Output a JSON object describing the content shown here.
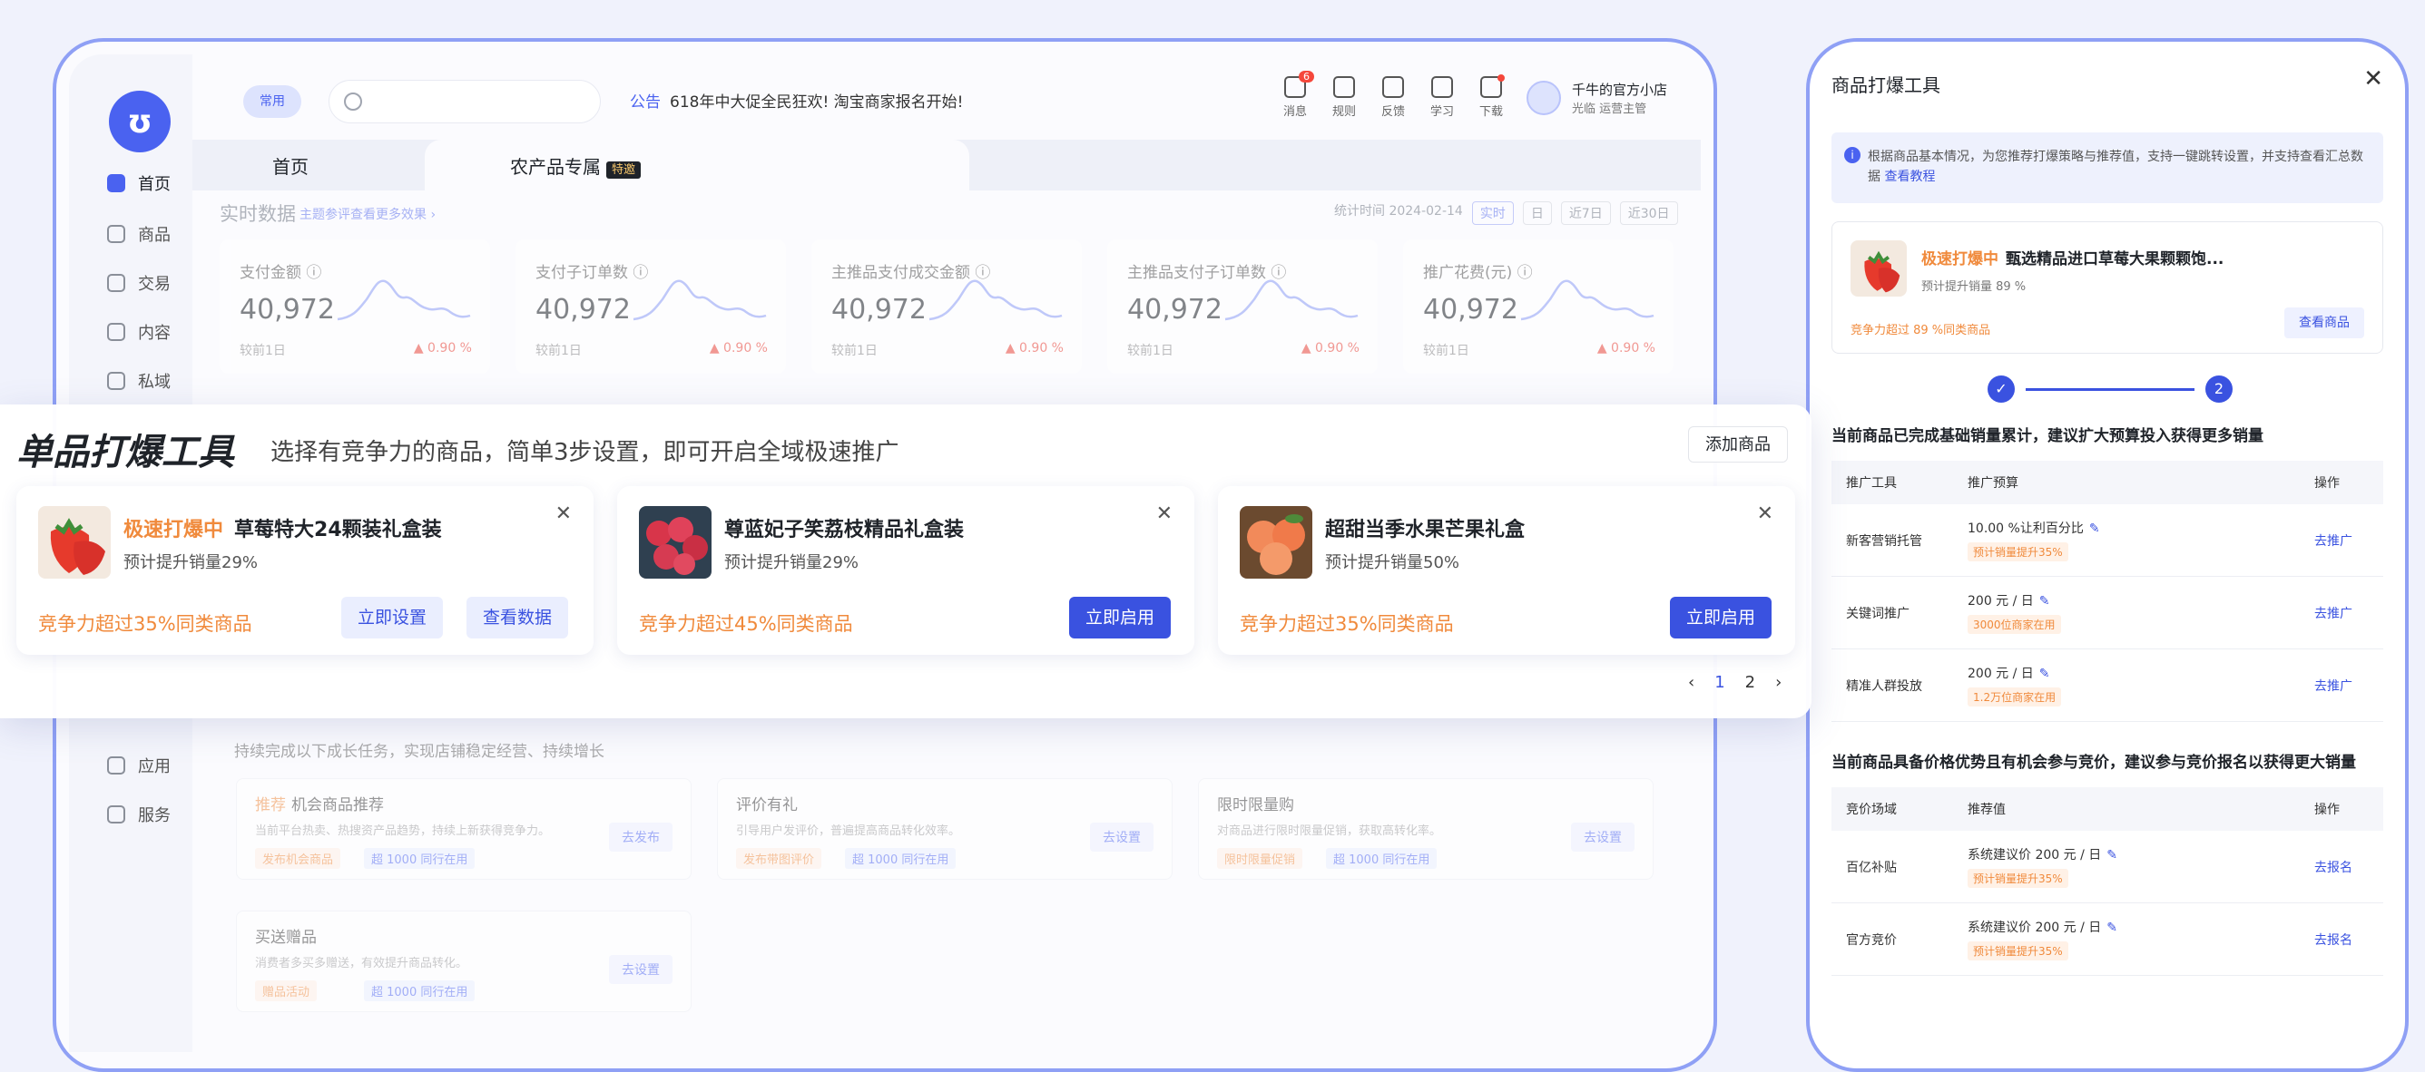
{
  "app": {
    "pill_tag": "常用",
    "search_placeholder": "",
    "notice_tag": "公告",
    "notice_text": "618年中大促全民狂欢! 淘宝商家报名开始!"
  },
  "tools": [
    {
      "label": "消息",
      "icon": "message-icon",
      "badge": "6"
    },
    {
      "label": "规则",
      "icon": "rules-icon"
    },
    {
      "label": "反馈",
      "icon": "feedback-icon"
    },
    {
      "label": "学习",
      "icon": "learn-icon"
    },
    {
      "label": "下载",
      "icon": "download-icon",
      "dot": true
    }
  ],
  "user": {
    "name": "千牛的官方小店",
    "sub": "光临  运营主管"
  },
  "sidebar": {
    "items": [
      {
        "label": "首页",
        "icon": "home-icon",
        "active": true
      },
      {
        "label": "商品",
        "icon": "goods-icon"
      },
      {
        "label": "交易",
        "icon": "trade-icon"
      },
      {
        "label": "内容",
        "icon": "content-icon"
      },
      {
        "label": "私域",
        "icon": "private-domain-icon"
      },
      {
        "label": "应用",
        "icon": "apps-icon"
      },
      {
        "label": "服务",
        "icon": "service-icon"
      }
    ]
  },
  "tabs": [
    {
      "label": "首页"
    },
    {
      "label": "农产品专属",
      "tag": "特邀"
    }
  ],
  "realtime": {
    "title": "实时数据",
    "link": "主题参评查看更多效果 ›",
    "update": "统计时间 2024-02-14",
    "ranges": [
      "实时",
      "日",
      "近7日",
      "近30日"
    ],
    "metrics": [
      {
        "label": "支付金额 ⓘ",
        "value": "40,972",
        "compare": "较前1日",
        "rate": "▲ 0.90 %"
      },
      {
        "label": "支付子订单数 ⓘ",
        "value": "40,972",
        "compare": "较前1日",
        "rate": "▲ 0.90 %"
      },
      {
        "label": "主推品支付成交金额 ⓘ",
        "value": "40,972",
        "compare": "较前1日",
        "rate": "▲ 0.90 %"
      },
      {
        "label": "主推品支付子订单数 ⓘ",
        "value": "40,972",
        "compare": "较前1日",
        "rate": "▲ 0.90 %"
      },
      {
        "label": "推广花费(元) ⓘ",
        "value": "40,972",
        "compare": "较前1日",
        "rate": "▲ 0.90 %"
      }
    ]
  },
  "growth": {
    "desc": "持续完成以下成长任务，实现店铺稳定经营、持续增长",
    "cards": [
      {
        "tag": "推荐",
        "title": "机会商品推荐",
        "desc": "当前平台热卖、热搜资产品趋势，持续上新获得竞争力。",
        "chip1": "发布机会商品",
        "chip2": "超 1000 同行在用",
        "btn": "去发布"
      },
      {
        "tag": "",
        "title": "评价有礼",
        "desc": "引导用户发评价，普遍提高商品转化效率。",
        "chip1": "发布带图评价",
        "chip2": "超 1000 同行在用",
        "btn": "去设置"
      },
      {
        "tag": "",
        "title": "限时限量购",
        "desc": "对商品进行限时限量促销，获取高转化率。",
        "chip1": "限时限量促销",
        "chip2": "超 1000 同行在用",
        "btn": "去设置"
      },
      {
        "tag": "",
        "title": "买送赠品",
        "desc": "消费者多买多赠送，有效提升商品转化。",
        "chip1": "赠品活动",
        "chip2": "超 1000 同行在用",
        "btn": "去设置"
      }
    ]
  },
  "overlay": {
    "title": "单品打爆工具",
    "subtitle": "选择有竞争力的商品，简单3步设置，即可开启全域极速推广",
    "add_btn": "添加商品",
    "products": [
      {
        "hot": "极速打爆中",
        "name": "草莓特大24颗装礼盒装",
        "lift": "预计提升销量29%",
        "comp": "竞争力超过35%同类商品",
        "btn1": "立即设置",
        "btn2": "查看数据",
        "fruit": "strawberry"
      },
      {
        "hot": "",
        "name": "尊蓝妃子笑荔枝精品礼盒装",
        "lift": "预计提升销量29%",
        "comp": "竞争力超过45%同类商品",
        "btn1": "立即启用",
        "fruit": "lychee"
      },
      {
        "hot": "",
        "name": "超甜当季水果芒果礼盒",
        "lift": "预计提升销量50%",
        "comp": "竞争力超过35%同类商品",
        "btn1": "立即启用",
        "fruit": "peach"
      }
    ],
    "pager": {
      "prev": "‹",
      "pages": [
        "1",
        "2"
      ],
      "current": "1",
      "next": "›"
    }
  },
  "panel": {
    "title": "商品打爆工具",
    "info": "根据商品基本情况，为您推荐打爆策略与推荐值，支持一键跳转设置，并支持查看汇总数据",
    "info_link": "查看教程",
    "product": {
      "hot": "极速打爆中",
      "name": "甄选精品进口草莓大果颗颗饱...",
      "lift": "预计提升销量 89 %",
      "comp": "竞争力超过 89 %同类商品",
      "btn": "查看商品"
    },
    "steps": {
      "done": "✓",
      "current": "2"
    },
    "sec1": {
      "title": "当前商品已完成基础销量累计，建议扩大预算投入获得更多销量",
      "head": [
        "推广工具",
        "推广预算",
        "操作"
      ],
      "rows": [
        {
          "tool": "新客营销托管",
          "budget": "10.00 %让利百分比",
          "chip": "预计销量提升35%",
          "op": "去推广"
        },
        {
          "tool": "关键词推广",
          "budget": "200 元 / 日",
          "chip": "3000位商家在用",
          "op": "去推广"
        },
        {
          "tool": "精准人群投放",
          "budget": "200 元 / 日",
          "chip": "1.2万位商家在用",
          "op": "去推广"
        }
      ]
    },
    "sec2": {
      "title": "当前商品具备价格优势且有机会参与竞价，建议参与竞价报名以获得更大销量",
      "head": [
        "竞价场域",
        "推荐值",
        "操作"
      ],
      "rows": [
        {
          "tool": "百亿补贴",
          "budget": "系统建议价 200 元 / 日",
          "chip": "预计销量提升35%",
          "op": "去报名"
        },
        {
          "tool": "官方竞价",
          "budget": "系统建议价 200 元 / 日",
          "chip": "预计销量提升35%",
          "op": "去报名"
        }
      ]
    }
  },
  "colors": {
    "accent": "#3a52e0",
    "frame": "#8fa0f5",
    "hot": "#f08a3c",
    "up": "#e9493d"
  }
}
